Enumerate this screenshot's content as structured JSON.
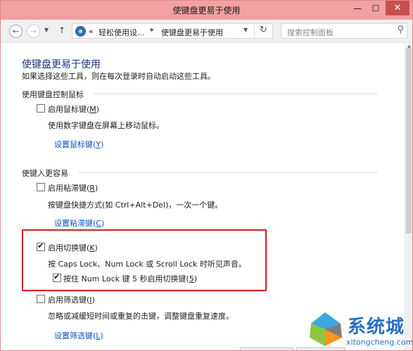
{
  "window": {
    "title": "使键盘更易于使用",
    "controls": {
      "minimize": "—",
      "maximize": "☐",
      "close": "✕"
    }
  },
  "navbar": {
    "back_icon": "←",
    "forward_icon": "→",
    "dropdown_icon": "▼",
    "up_icon": "↑",
    "breadcrumb": {
      "overflow": "«",
      "items": [
        "轻松使用设...",
        "使键盘更易于使用"
      ],
      "separator": "▸"
    },
    "refresh_icon": "↻",
    "search_placeholder": "搜索控制面板",
    "search_icon": "⚲"
  },
  "main": {
    "title": "使键盘更易于使用",
    "description": "如果选择这些工具，则在每次登录时自动启动这些工具。",
    "sections": [
      {
        "heading": "使用键盘控制鼠标",
        "option": {
          "label": "启用鼠标键(M)",
          "checked": false
        },
        "detail": "使用数字键盘在屏幕上移动鼠标。",
        "link": "设置鼠标键(Y)"
      },
      {
        "heading": "使键入更容易",
        "options": [
          {
            "label": "启用粘滞键(R)",
            "checked": false,
            "detail": "按键盘快捷方式(如 Ctrl+Alt+Del)，一次一个键。",
            "link": "设置粘滞键(C)"
          },
          {
            "label": "启用切换键(K)",
            "checked": true,
            "detail": "按 Caps Lock、Num Lock 或 Scroll Lock 时听见声音。",
            "sub_option": {
              "label": "按住 Num Lock 键 5 秒启用切换键(5)",
              "checked": true
            }
          },
          {
            "label": "启用筛选键(I)",
            "checked": false,
            "detail": "忽略或减缓短时间或重复的击键，调整键盘重复速度。",
            "link": "设置筛选键(L)"
          }
        ]
      }
    ]
  },
  "watermark": {
    "brand": "系统城",
    "url": "xitongcheng.com",
    "colors": [
      "#2a6fc5",
      "#8cc63f",
      "#f7941d",
      "#3aa7e0"
    ]
  },
  "colors": {
    "titlebar": "#f2a0a0",
    "close_button": "#c7504f",
    "link": "#0a55b8",
    "page_title": "#1e3287",
    "highlight_box": "#d81e1e"
  }
}
